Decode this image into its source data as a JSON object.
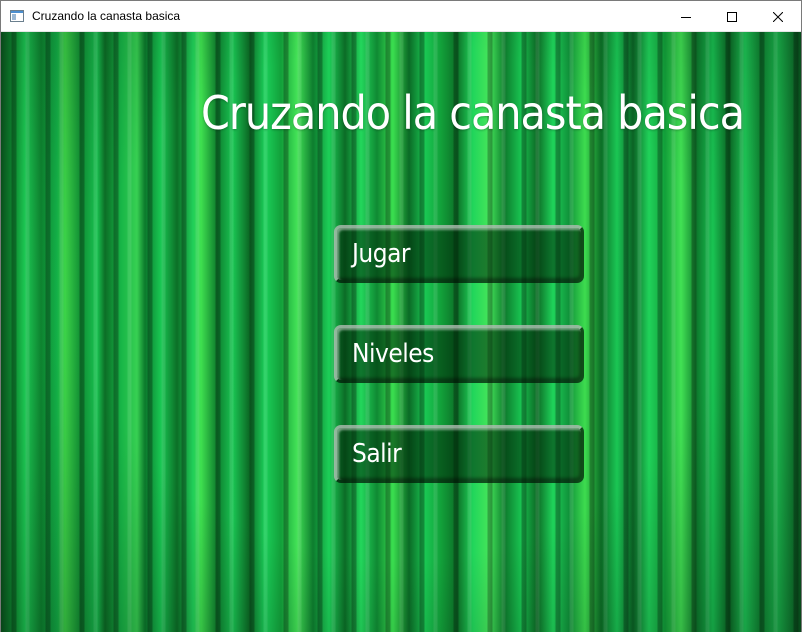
{
  "window": {
    "title": "Cruzando la canasta basica",
    "icons": {
      "app": "app-window-icon",
      "minimize": "minimize-icon",
      "maximize": "maximize-icon",
      "close": "close-icon"
    }
  },
  "game": {
    "title": "Cruzando la canasta basica",
    "menu": [
      {
        "id": "jugar",
        "label": "Jugar"
      },
      {
        "id": "niveles",
        "label": "Niveles"
      },
      {
        "id": "salir",
        "label": "Salir"
      }
    ]
  },
  "colors": {
    "background_green": "#12a83d",
    "title_text": "#ffffff",
    "button_fill": "#06320f"
  }
}
